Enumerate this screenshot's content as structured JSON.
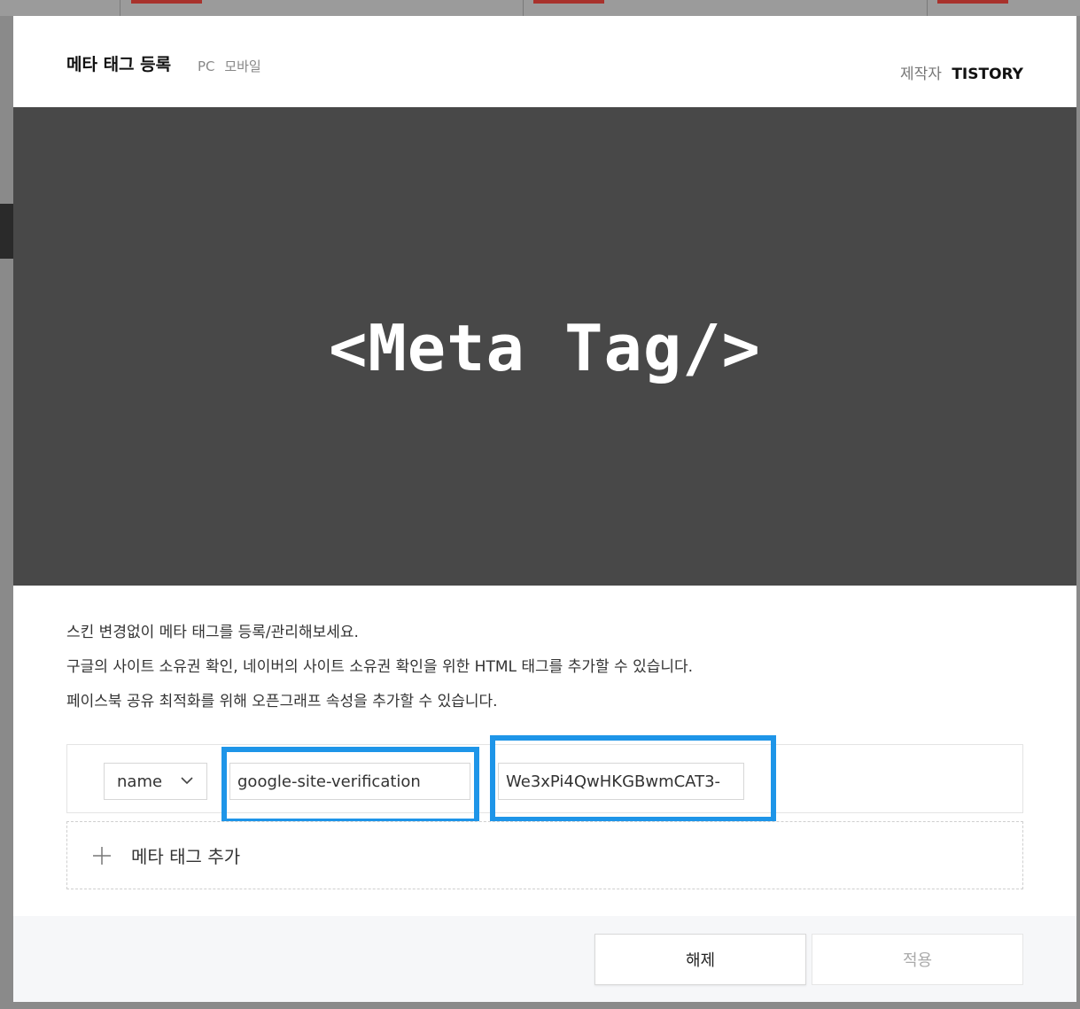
{
  "modal": {
    "title": "메타 태그 등록",
    "platform_tags": [
      "PC",
      "모바일"
    ],
    "maker_label": "제작자",
    "maker_value": "TISTORY"
  },
  "banner": {
    "text": "<Meta Tag/>"
  },
  "description": [
    "스킨 변경없이 메타 태그를 등록/관리해보세요.",
    "구글의 사이트 소유권 확인, 네이버의 사이트 소유권 확인을 위한 HTML 태그를 추가할 수 있습니다.",
    "페이스북 공유 최적화를 위해 오픈그래프 속성을 추가할 수 있습니다."
  ],
  "meta_tag_row": {
    "attribute_select": "name",
    "name_value": "google-site-verification",
    "content_value": "We3xPi4QwHKGBwmCAT3-"
  },
  "add_meta_tag_label": "메타 태그 추가",
  "buttons": {
    "release": "해제",
    "apply": "적용"
  },
  "colors": {
    "highlight": "#1e95e8",
    "banner_bg": "#484848",
    "footer_bg": "#f6f7f9"
  },
  "icons": {
    "select_chevron": "chevron-down-icon",
    "add": "plus-icon"
  }
}
